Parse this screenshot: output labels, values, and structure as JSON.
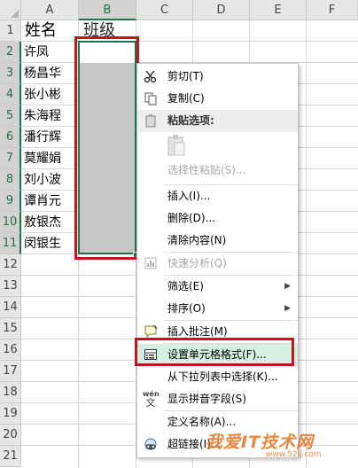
{
  "spreadsheet": {
    "columns": [
      "A",
      "B",
      "C",
      "D",
      "E",
      "F"
    ],
    "selected_column": "B",
    "rows": [
      "1",
      "2",
      "3",
      "4",
      "5",
      "6",
      "7",
      "8",
      "9",
      "10",
      "11",
      "12",
      "13",
      "14",
      "15",
      "16",
      "17",
      "18",
      "19",
      "20",
      "21"
    ],
    "selected_rows": [
      "2",
      "3",
      "4",
      "5",
      "6",
      "7",
      "8",
      "9",
      "10",
      "11"
    ],
    "header_a": "姓名",
    "header_b": "班级",
    "names": [
      "许凤",
      "杨昌华",
      "张小彬",
      "朱海程",
      "潘行辉",
      "莫耀娟",
      "刘小波",
      "谭肖元",
      "敖银杰",
      "闵银生"
    ]
  },
  "context_menu": {
    "cut": "剪切(T)",
    "copy": "复制(C)",
    "paste_options": "粘贴选项:",
    "paste_special": "选择性粘贴(S)...",
    "insert": "插入(I)...",
    "delete": "删除(D)...",
    "clear_contents": "清除内容(N)",
    "quick_analysis": "快速分析(Q)",
    "filter": "筛选(E)",
    "sort": "排序(O)",
    "insert_comment": "插入批注(M)",
    "format_cells": "设置单元格格式(F)...",
    "pick_from_list": "从下拉列表中选择(K)...",
    "phonetic": "显示拼音字段(S)",
    "define_name": "定义名称(A)...",
    "hyperlink": "超链接(I)...",
    "phonetic_icon_text": "wén",
    "phonetic_icon_char": "文"
  },
  "watermark": {
    "text": "我爱IT技术网",
    "url": "www.52ij.com"
  },
  "colors": {
    "excel_green": "#217346",
    "highlight_red": "#c0141e",
    "menu_highlight": "#d3f0e0"
  }
}
